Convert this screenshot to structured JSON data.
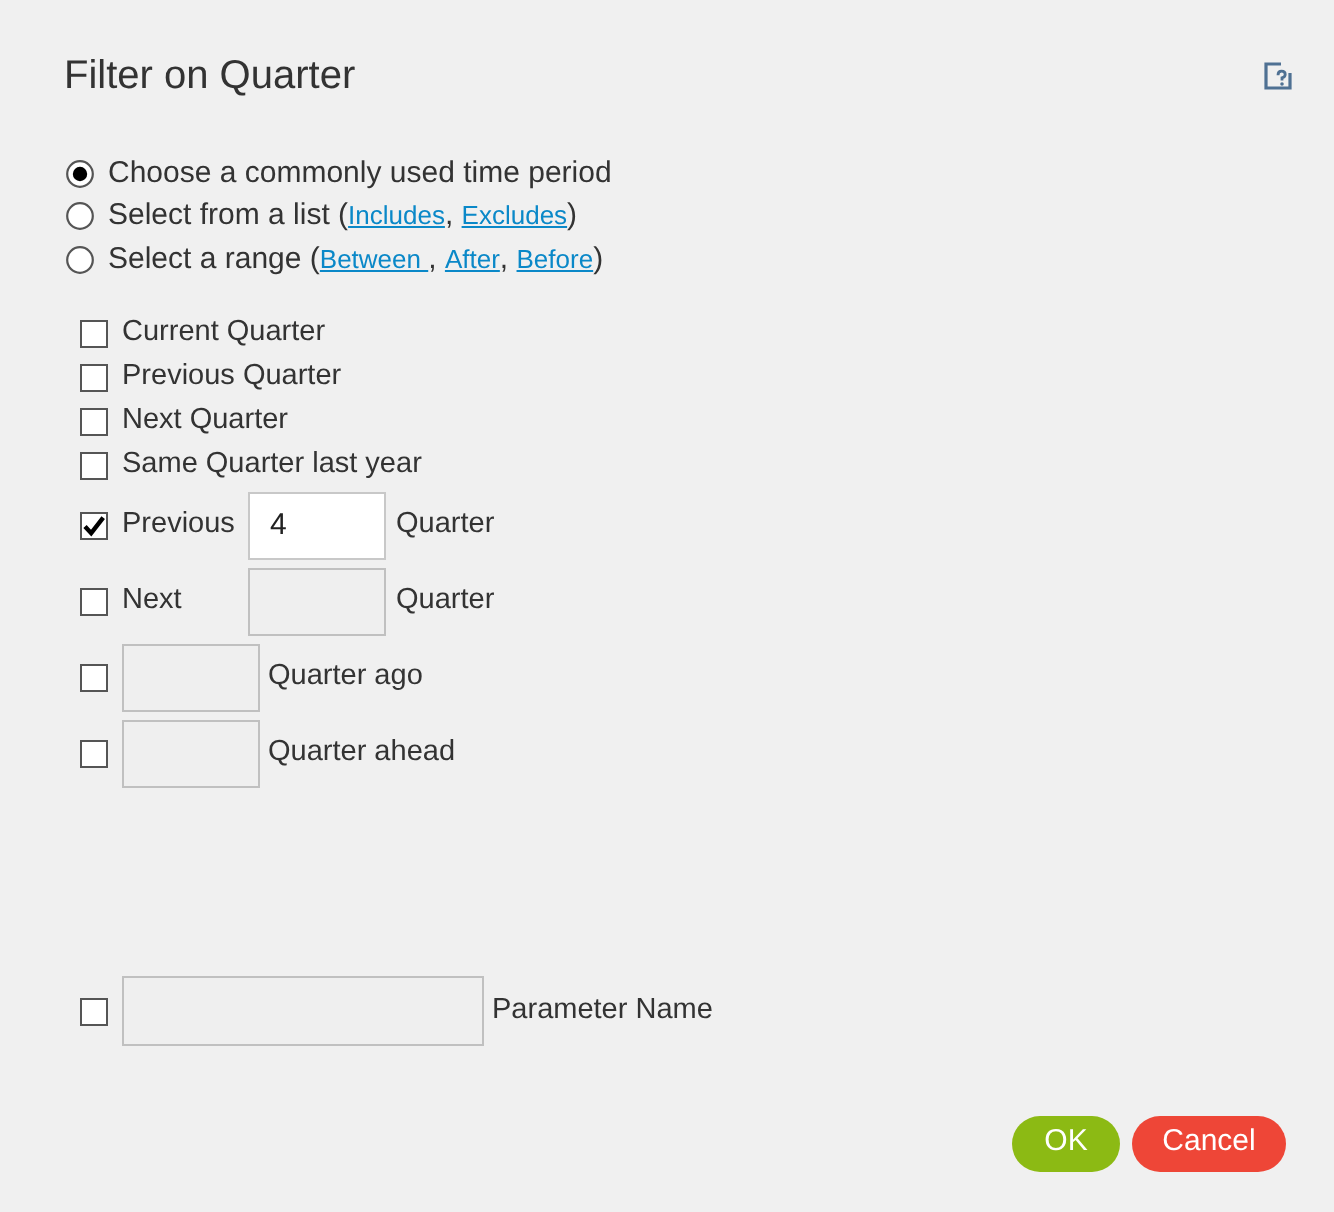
{
  "dialog": {
    "title": "Filter on Quarter"
  },
  "modes": [
    {
      "selected": true,
      "parts": [
        {
          "kind": "text",
          "text": "Choose a commonly used time period"
        }
      ]
    },
    {
      "selected": false,
      "parts": [
        {
          "kind": "text",
          "text": "Select from a list ("
        },
        {
          "kind": "link",
          "text": "Includes"
        },
        {
          "kind": "text",
          "text": ", "
        },
        {
          "kind": "link",
          "text": "Excludes"
        },
        {
          "kind": "text",
          "text": ")"
        }
      ]
    },
    {
      "selected": false,
      "parts": [
        {
          "kind": "text",
          "text": "Select a range ("
        },
        {
          "kind": "link",
          "text": "Between "
        },
        {
          "kind": "text",
          "text": ", "
        },
        {
          "kind": "link",
          "text": "After"
        },
        {
          "kind": "text",
          "text": ", "
        },
        {
          "kind": "link",
          "text": "Before"
        },
        {
          "kind": "text",
          "text": ")"
        }
      ]
    }
  ],
  "periods": [
    {
      "kind": "plain",
      "label": "Current Quarter",
      "checked": false
    },
    {
      "kind": "plain",
      "label": "Previous Quarter",
      "checked": false
    },
    {
      "kind": "plain",
      "label": "Next Quarter",
      "checked": false
    },
    {
      "kind": "plain",
      "label": "Same Quarter last year",
      "checked": false
    },
    {
      "kind": "field",
      "prefix": "Previous",
      "value": "4",
      "suffix": "Quarter",
      "checked": true
    },
    {
      "kind": "field",
      "prefix": "Next",
      "suffix": "Quarter",
      "checked": false
    },
    {
      "kind": "field",
      "suffix": "Quarter ago",
      "checked": false
    },
    {
      "kind": "field",
      "suffix": "Quarter ahead",
      "checked": false
    }
  ],
  "parameter": {
    "checked": false,
    "label": "Parameter Name"
  },
  "buttons": [
    {
      "kind": "ok",
      "label": "OK"
    },
    {
      "kind": "cancel",
      "label": "Cancel"
    }
  ]
}
